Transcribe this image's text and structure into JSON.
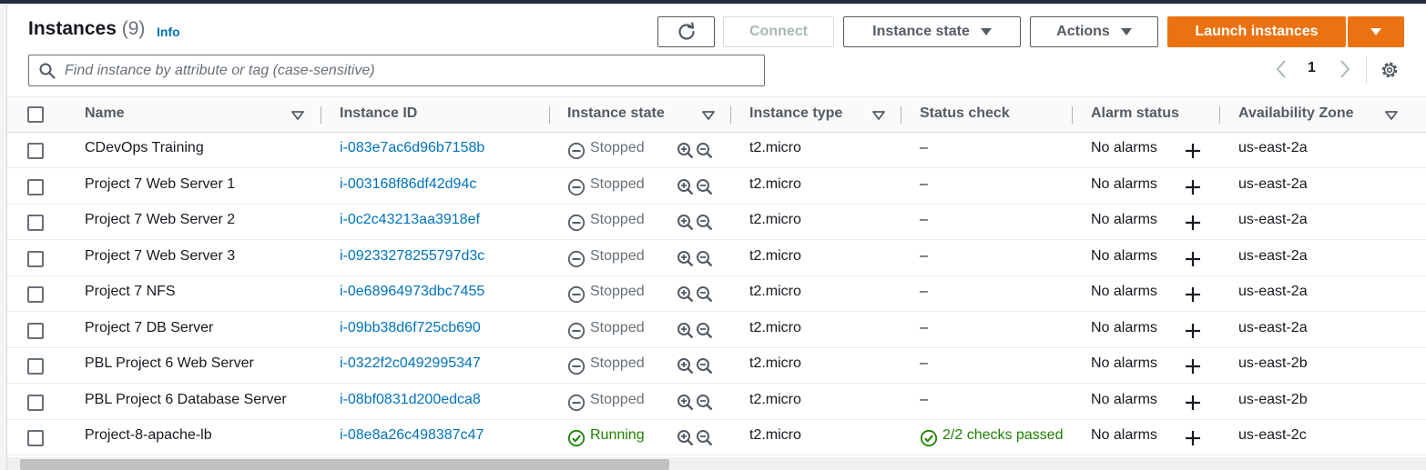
{
  "header": {
    "title": "Instances",
    "count": "(9)",
    "info_label": "Info"
  },
  "toolbar": {
    "connect_label": "Connect",
    "instance_state_label": "Instance state",
    "actions_label": "Actions",
    "launch_label": "Launch instances"
  },
  "search": {
    "placeholder": "Find instance by attribute or tag (case-sensitive)"
  },
  "pagination": {
    "current_page": "1"
  },
  "columns": [
    "Name",
    "Instance ID",
    "Instance state",
    "Instance type",
    "Status check",
    "Alarm status",
    "Availability Zone"
  ],
  "rows": [
    {
      "name": "CDevOps Training",
      "id": "i-083e7ac6d96b7158b",
      "state": "Stopped",
      "type": "t2.micro",
      "status": "–",
      "alarm": "No alarms",
      "zone": "us-east-2a"
    },
    {
      "name": "Project 7 Web Server 1",
      "id": "i-003168f86df42d94c",
      "state": "Stopped",
      "type": "t2.micro",
      "status": "–",
      "alarm": "No alarms",
      "zone": "us-east-2a"
    },
    {
      "name": "Project 7 Web Server 2",
      "id": "i-0c2c43213aa3918ef",
      "state": "Stopped",
      "type": "t2.micro",
      "status": "–",
      "alarm": "No alarms",
      "zone": "us-east-2a"
    },
    {
      "name": "Project 7 Web Server 3",
      "id": "i-09233278255797d3c",
      "state": "Stopped",
      "type": "t2.micro",
      "status": "–",
      "alarm": "No alarms",
      "zone": "us-east-2a"
    },
    {
      "name": "Project 7 NFS",
      "id": "i-0e68964973dbc7455",
      "state": "Stopped",
      "type": "t2.micro",
      "status": "–",
      "alarm": "No alarms",
      "zone": "us-east-2a"
    },
    {
      "name": "Project 7 DB Server",
      "id": "i-09bb38d6f725cb690",
      "state": "Stopped",
      "type": "t2.micro",
      "status": "–",
      "alarm": "No alarms",
      "zone": "us-east-2a"
    },
    {
      "name": "PBL Project 6 Web Server",
      "id": "i-0322f2c0492995347",
      "state": "Stopped",
      "type": "t2.micro",
      "status": "–",
      "alarm": "No alarms",
      "zone": "us-east-2b"
    },
    {
      "name": "PBL Project 6 Database Server",
      "id": "i-08bf0831d200edca8",
      "state": "Stopped",
      "type": "t2.micro",
      "status": "–",
      "alarm": "No alarms",
      "zone": "us-east-2b"
    },
    {
      "name": "Project-8-apache-lb",
      "id": "i-08e8a26c498387c47",
      "state": "Running",
      "type": "t2.micro",
      "status": "2/2 checks passed",
      "alarm": "No alarms",
      "zone": "us-east-2c"
    }
  ],
  "colors": {
    "primary": "#ec7211",
    "link": "#0073bb",
    "running": "#1d8102",
    "stopped": "#687078"
  },
  "icons": [
    "refresh-icon",
    "caret-down-icon",
    "search-icon",
    "chevron-left-icon",
    "chevron-right-icon",
    "gear-icon",
    "sort-caret-icon",
    "stopped-icon",
    "running-icon",
    "zoom-in-icon",
    "zoom-out-icon",
    "add-alarm-icon",
    "check-circle-icon"
  ]
}
